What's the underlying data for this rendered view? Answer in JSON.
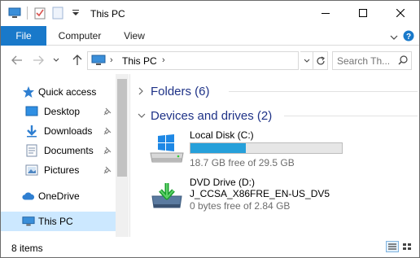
{
  "window": {
    "title": "This PC"
  },
  "ribbon": {
    "tabs": [
      {
        "label": "File"
      },
      {
        "label": "Computer"
      },
      {
        "label": "View"
      }
    ]
  },
  "address": {
    "path": "This PC"
  },
  "search": {
    "placeholder": "Search Th..."
  },
  "nav": {
    "items": [
      {
        "label": "Quick access",
        "icon": "star-icon"
      },
      {
        "label": "Desktop",
        "icon": "desktop-folder-icon",
        "pinned": true
      },
      {
        "label": "Downloads",
        "icon": "downloads-folder-icon",
        "pinned": true
      },
      {
        "label": "Documents",
        "icon": "documents-folder-icon",
        "pinned": true
      },
      {
        "label": "Pictures",
        "icon": "pictures-folder-icon",
        "pinned": true
      },
      {
        "label": "OneDrive",
        "icon": "onedrive-cloud-icon"
      },
      {
        "label": "This PC",
        "icon": "computer-icon",
        "selected": true
      }
    ]
  },
  "content": {
    "groups": [
      {
        "title": "Folders (6)",
        "expanded": false
      },
      {
        "title": "Devices and drives (2)",
        "expanded": true
      }
    ],
    "drives": [
      {
        "name": "Local Disk (C:)",
        "free_text": "18.7 GB free of 29.5 GB",
        "used_fraction": 0.366
      },
      {
        "name": "DVD Drive (D:)",
        "label": "J_CCSA_X86FRE_EN-US_DV5",
        "free_text": "0 bytes free of 2.84 GB"
      }
    ]
  },
  "status": {
    "item_count": "8 items"
  },
  "colors": {
    "accent": "#1979ca",
    "selection": "#cce8ff",
    "usage_bar": "#26a0da",
    "group_title": "#1e3287"
  }
}
